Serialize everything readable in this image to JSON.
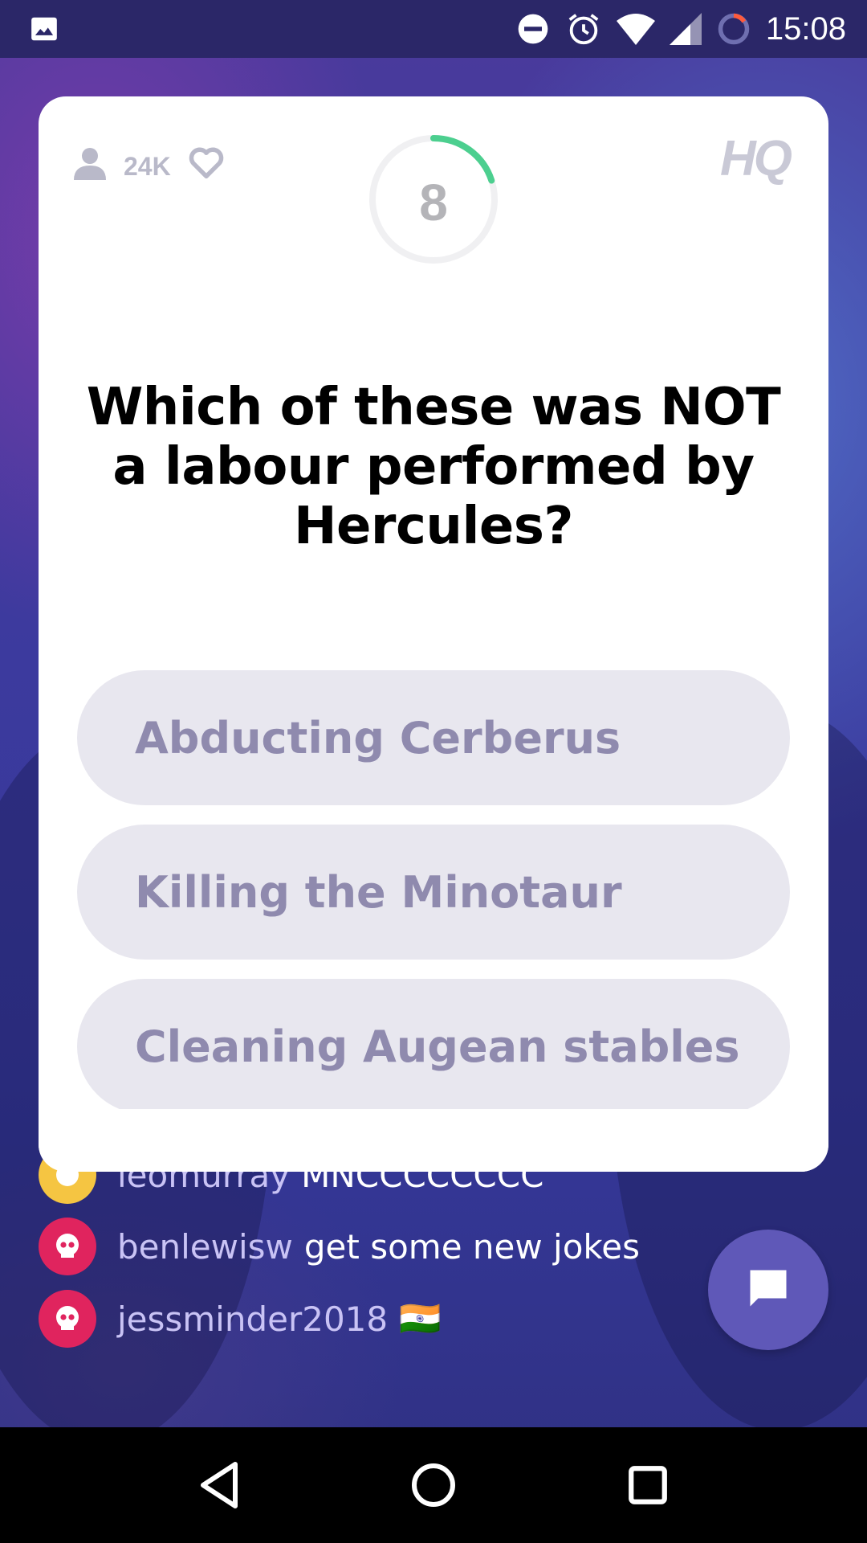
{
  "status_bar": {
    "time": "15:08",
    "icons": [
      "image-icon",
      "do-not-disturb-icon",
      "alarm-icon",
      "wifi-icon",
      "signal-icon",
      "battery-icon"
    ]
  },
  "card": {
    "viewer_count": "24K",
    "timer_value": "8",
    "timer_progress": 0.2,
    "logo": "HQ",
    "question": "Which of these was NOT a labour performed by Hercules?",
    "answers": [
      "Abducting Cerberus",
      "Killing the Minotaur",
      "Cleaning Augean stables"
    ]
  },
  "chat": {
    "messages": [
      {
        "user": "leomurray",
        "text": "MNCCCCCCCC",
        "avatar_color": "#f5c542"
      },
      {
        "user": "benlewisw",
        "text": "get some new jokes",
        "avatar_color": "#e0245e"
      },
      {
        "user": "jessminder2018",
        "text": "🇮🇳",
        "avatar_color": "#e0245e"
      }
    ]
  },
  "colors": {
    "card_bg": "#ffffff",
    "answer_bg": "#e8e7ef",
    "answer_text": "#8f8aae",
    "timer_ring": "#4ccf8f",
    "chat_button": "#5f58b8"
  }
}
